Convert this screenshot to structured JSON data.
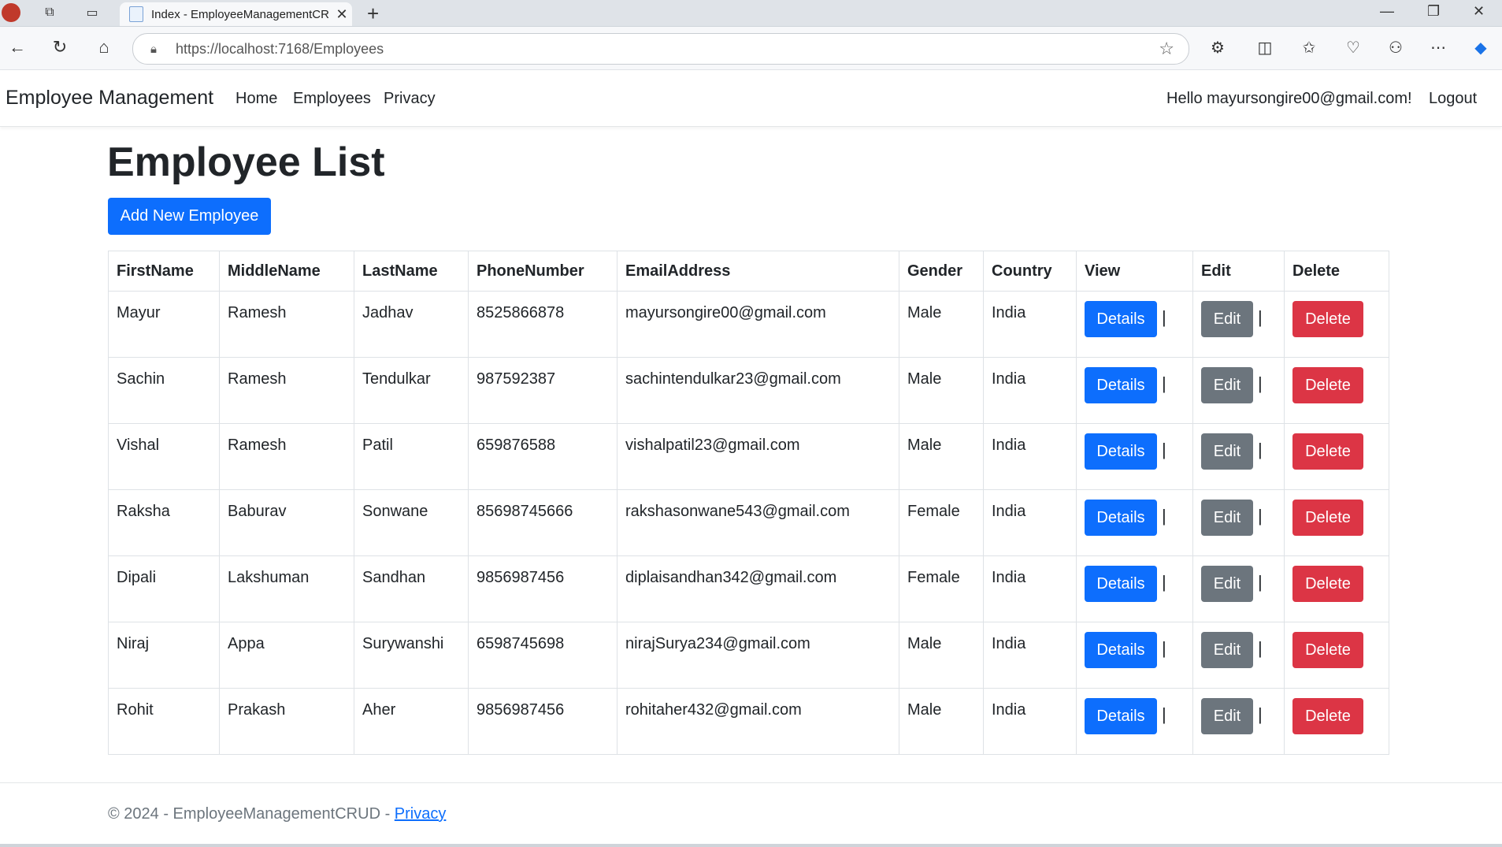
{
  "browser": {
    "tab_title": "Index - EmployeeManagementCR",
    "url": "https://localhost:7168/Employees"
  },
  "navbar": {
    "brand": "Employee Management",
    "links": [
      "Home",
      "Employees",
      "Privacy"
    ],
    "greeting": "Hello mayursongire00@gmail.com!",
    "logout": "Logout"
  },
  "main": {
    "title": "Employee List",
    "add_button": "Add New Employee",
    "columns": [
      "FirstName",
      "MiddleName",
      "LastName",
      "PhoneNumber",
      "EmailAddress",
      "Gender",
      "Country",
      "View",
      "Edit",
      "Delete"
    ],
    "action_labels": {
      "details": "Details",
      "edit": "Edit",
      "delete": "Delete",
      "separator": "|"
    },
    "rows": [
      [
        "Mayur",
        "Ramesh",
        "Jadhav",
        "8525866878",
        "mayursongire00@gmail.com",
        "Male",
        "India"
      ],
      [
        "Sachin",
        "Ramesh",
        "Tendulkar",
        "987592387",
        "sachintendulkar23@gmail.com",
        "Male",
        "India"
      ],
      [
        "Vishal",
        "Ramesh",
        "Patil",
        "659876588",
        "vishalpatil23@gmail.com",
        "Male",
        "India"
      ],
      [
        "Raksha",
        "Baburav",
        "Sonwane",
        "85698745666",
        "rakshasonwane543@gmail.com",
        "Female",
        "India"
      ],
      [
        "Dipali",
        "Lakshuman",
        "Sandhan",
        "9856987456",
        "diplaisandhan342@gmail.com",
        "Female",
        "India"
      ],
      [
        "Niraj",
        "Appa",
        "Surywanshi",
        "6598745698",
        "nirajSurya234@gmail.com",
        "Male",
        "India"
      ],
      [
        "Rohit",
        "Prakash",
        "Aher",
        "9856987456",
        "rohitaher432@gmail.com",
        "Male",
        "India"
      ]
    ]
  },
  "footer": {
    "text": "© 2024 - EmployeeManagementCRUD - ",
    "privacy": "Privacy"
  },
  "colors": {
    "primary": "#0d6efd",
    "secondary": "#6c757d",
    "danger": "#dc3545"
  }
}
